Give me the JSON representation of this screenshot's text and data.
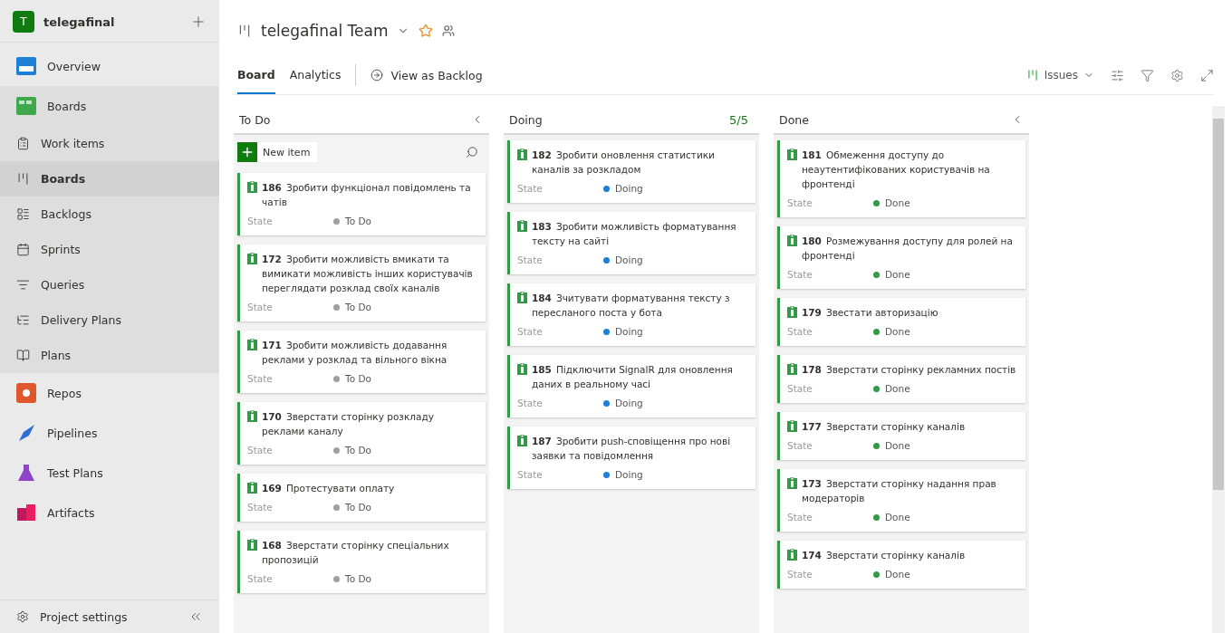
{
  "project": {
    "initial": "T",
    "name": "telegafinal"
  },
  "sidebar": {
    "items": [
      {
        "label": "Overview",
        "kind": "overview",
        "selected": false
      },
      {
        "label": "Boards",
        "kind": "boards",
        "selected": false,
        "children": [
          {
            "label": "Work items",
            "kind": "workitems",
            "selected": false
          },
          {
            "label": "Boards",
            "kind": "board",
            "selected": true
          },
          {
            "label": "Backlogs",
            "kind": "backlogs",
            "selected": false
          },
          {
            "label": "Sprints",
            "kind": "sprints",
            "selected": false
          },
          {
            "label": "Queries",
            "kind": "queries",
            "selected": false
          },
          {
            "label": "Delivery Plans",
            "kind": "deliveryplans",
            "selected": false
          },
          {
            "label": "Plans",
            "kind": "plans",
            "selected": false
          }
        ]
      },
      {
        "label": "Repos",
        "kind": "repos",
        "selected": false
      },
      {
        "label": "Pipelines",
        "kind": "pipelines",
        "selected": false
      },
      {
        "label": "Test Plans",
        "kind": "testplans",
        "selected": false
      },
      {
        "label": "Artifacts",
        "kind": "artifacts",
        "selected": false
      }
    ],
    "settings": "Project settings"
  },
  "header": {
    "team": "telegafinal Team",
    "favorite": false
  },
  "tabs": [
    {
      "label": "Board",
      "selected": true
    },
    {
      "label": "Analytics",
      "selected": false
    }
  ],
  "view_as_backlog": "View as Backlog",
  "backlog_level": "Issues",
  "columns": [
    {
      "name": "To Do",
      "collapsible": true,
      "new_item": "New item",
      "cards": [
        {
          "id": "186",
          "title": "Зробити функціонал повідомлень та чатів",
          "field": "State",
          "state": "To Do",
          "color": "#a0a0a0"
        },
        {
          "id": "172",
          "title": "Зробити можливість вмикати та вимикати можливість інших користувачів переглядати розклад своїх каналів",
          "field": "State",
          "state": "To Do",
          "color": "#a0a0a0"
        },
        {
          "id": "171",
          "title": "Зробити можливість додавання реклами у розклад та вільного вікна",
          "field": "State",
          "state": "To Do",
          "color": "#a0a0a0"
        },
        {
          "id": "170",
          "title": "Зверстати сторінку розкладу реклами каналу",
          "field": "State",
          "state": "To Do",
          "color": "#a0a0a0"
        },
        {
          "id": "169",
          "title": "Протестувати оплату",
          "field": "State",
          "state": "To Do",
          "color": "#a0a0a0"
        },
        {
          "id": "168",
          "title": "Зверстати сторінку спеціальних пропозицій",
          "field": "State",
          "state": "To Do",
          "color": "#a0a0a0"
        }
      ]
    },
    {
      "name": "Doing",
      "count": "5/5",
      "collapsible": false,
      "cards": [
        {
          "id": "182",
          "title": "Зробити оновлення статистики каналів за розкладом",
          "field": "State",
          "state": "Doing",
          "color": "#1e7fd6"
        },
        {
          "id": "183",
          "title": "Зробити можливість форматування тексту на сайті",
          "field": "State",
          "state": "Doing",
          "color": "#1e7fd6"
        },
        {
          "id": "184",
          "title": "Зчитувати форматування тексту з пересланого поста у бота",
          "field": "State",
          "state": "Doing",
          "color": "#1e7fd6"
        },
        {
          "id": "185",
          "title": "Підключити SignalR для оновлення даних в реальному часі",
          "field": "State",
          "state": "Doing",
          "color": "#1e7fd6"
        },
        {
          "id": "187",
          "title": "Зробити push-сповіщення про нові заявки та повідомлення",
          "field": "State",
          "state": "Doing",
          "color": "#1e7fd6"
        }
      ]
    },
    {
      "name": "Done",
      "collapsible": true,
      "cards": [
        {
          "id": "181",
          "title": "Обмеження доступу до неаутентифікованих користувачів на фронтенді",
          "field": "State",
          "state": "Done",
          "color": "#339947"
        },
        {
          "id": "180",
          "title": "Розмежування доступу для ролей на фронтенді",
          "field": "State",
          "state": "Done",
          "color": "#339947"
        },
        {
          "id": "179",
          "title": "Звестати авторизацію",
          "field": "State",
          "state": "Done",
          "color": "#339947"
        },
        {
          "id": "178",
          "title": "Зверстати сторінку рекламних постів",
          "field": "State",
          "state": "Done",
          "color": "#339947"
        },
        {
          "id": "177",
          "title": "Зверстати сторінку каналів",
          "field": "State",
          "state": "Done",
          "color": "#339947"
        },
        {
          "id": "173",
          "title": "Зверстати сторінку надання прав модераторів",
          "field": "State",
          "state": "Done",
          "color": "#339947"
        },
        {
          "id": "174",
          "title": "Зверстати сторінку каналів",
          "field": "State",
          "state": "Done",
          "color": "#339947"
        }
      ]
    }
  ]
}
